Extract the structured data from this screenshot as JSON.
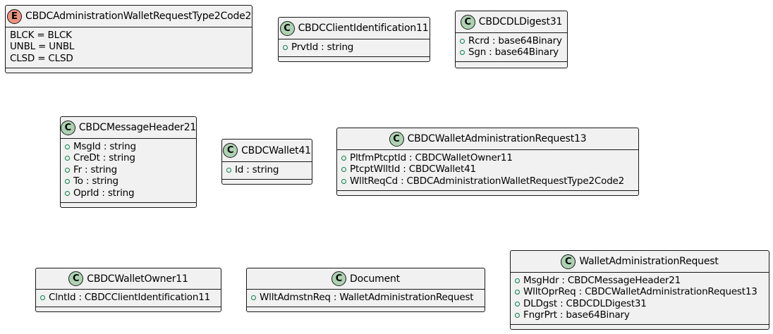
{
  "diagram": {
    "boxes": [
      {
        "id": "enum-wallet-request-type",
        "kind": "enum",
        "badge": "E",
        "title": "CBDCAdministrationWalletRequestType2Code2",
        "fields": [
          "BLCK = BLCK",
          "UNBL = UNBL",
          "CLSD = CLSD"
        ]
      },
      {
        "id": "class-client-identification",
        "kind": "class",
        "badge": "C",
        "title": "CBDCClientIdentification11",
        "fields": [
          "PrvtId : string"
        ]
      },
      {
        "id": "class-dl-digest",
        "kind": "class",
        "badge": "C",
        "title": "CBDCDLDigest31",
        "fields": [
          "Rcrd : base64Binary",
          "Sgn : base64Binary"
        ]
      },
      {
        "id": "class-message-header",
        "kind": "class",
        "badge": "C",
        "title": "CBDCMessageHeader21",
        "fields": [
          "MsgId : string",
          "CreDt : string",
          "Fr : string",
          "To : string",
          "OprId : string"
        ]
      },
      {
        "id": "class-wallet",
        "kind": "class",
        "badge": "C",
        "title": "CBDCWallet41",
        "fields": [
          "Id : string"
        ]
      },
      {
        "id": "class-wallet-admin-request",
        "kind": "class",
        "badge": "C",
        "title": "CBDCWalletAdministrationRequest13",
        "fields": [
          "PltfmPtcptId : CBDCWalletOwner11",
          "PtcptWlltId : CBDCWallet41",
          "WlltReqCd : CBDCAdministrationWalletRequestType2Code2"
        ]
      },
      {
        "id": "class-wallet-owner",
        "kind": "class",
        "badge": "C",
        "title": "CBDCWalletOwner11",
        "fields": [
          "ClntId : CBDCClientIdentification11"
        ]
      },
      {
        "id": "class-document",
        "kind": "class",
        "badge": "C",
        "title": "Document",
        "fields": [
          "WlltAdmstnReq : WalletAdministrationRequest"
        ]
      },
      {
        "id": "class-wallet-administration-request",
        "kind": "class",
        "badge": "C",
        "title": "WalletAdministrationRequest",
        "fields": [
          "MsgHdr : CBDCMessageHeader21",
          "WlltOprReq : CBDCWalletAdministrationRequest13",
          "DLDgst : CBDCDLDigest31",
          "FngrPrt : base64Binary"
        ]
      }
    ]
  },
  "colors": {
    "box_fill": "#f1f1f1",
    "border": "#181818",
    "class_badge": "#add1b2",
    "enum_badge": "#eb937f",
    "public_visibility": "#038048"
  }
}
